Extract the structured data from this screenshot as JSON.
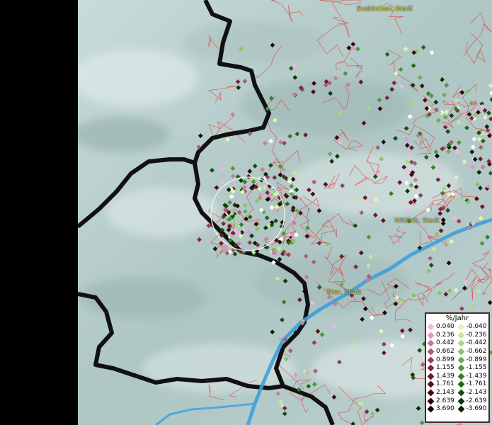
{
  "map": {
    "labels": [
      {
        "id": "euskirchen",
        "text": "Euskirchen, Stadt"
      },
      {
        "id": "wittlich",
        "text": "Wittlich, Stadt"
      },
      {
        "id": "trier",
        "text": "Trier, Stadt"
      }
    ],
    "colors": {
      "terrain": "#b8cdcb",
      "border": "#111111",
      "district_lines": "#e04040",
      "river": "#3f9fd8"
    }
  },
  "legend": {
    "title": "%/Jahr",
    "positive": [
      {
        "value": "0.040",
        "color": "#f4b6de"
      },
      {
        "value": "0.236",
        "color": "#e296c0"
      },
      {
        "value": "0.442",
        "color": "#cc7a9c"
      },
      {
        "value": "0.662",
        "color": "#b05a7a"
      },
      {
        "value": "0.899",
        "color": "#94405a"
      },
      {
        "value": "1.155",
        "color": "#7e2a40"
      },
      {
        "value": "1.439",
        "color": "#6a1a2c"
      },
      {
        "value": "1.761",
        "color": "#56101c"
      },
      {
        "value": "2.143",
        "color": "#440810"
      },
      {
        "value": "2.639",
        "color": "#300408"
      },
      {
        "value": "3.690",
        "color": "#1a0204"
      }
    ],
    "negative": [
      {
        "value": "-0.040",
        "color": "#e4f4b4"
      },
      {
        "value": "-0.236",
        "color": "#c4e8a0"
      },
      {
        "value": "-0.442",
        "color": "#a6d884"
      },
      {
        "value": "-0.662",
        "color": "#86c46a"
      },
      {
        "value": "-0.899",
        "color": "#68ae50"
      },
      {
        "value": "-1.155",
        "color": "#4e963a"
      },
      {
        "value": "-1.439",
        "color": "#387e28"
      },
      {
        "value": "-1.761",
        "color": "#24661a"
      },
      {
        "value": "-2.143",
        "color": "#164e10"
      },
      {
        "value": "-2.639",
        "color": "#0c3808"
      },
      {
        "value": "-3.690",
        "color": "#052204"
      }
    ]
  }
}
